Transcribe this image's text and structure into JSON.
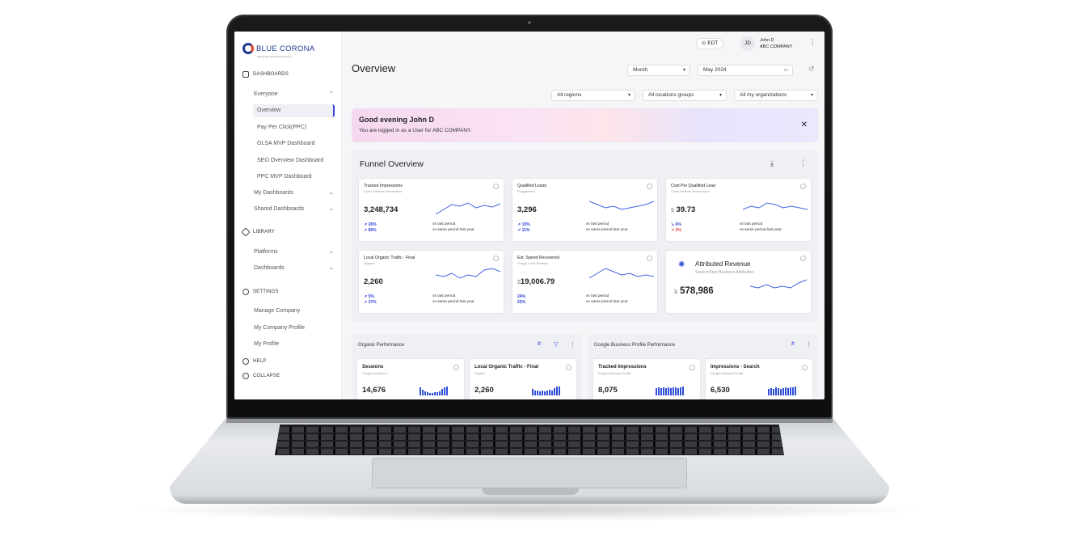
{
  "brand": {
    "name": "BLUE CORONA",
    "tagline": "Measurable Marketing Solutions"
  },
  "sidebar": {
    "dashboards_label": "DASHBOARDS",
    "everyone_label": "Everyone",
    "everyone_items": [
      "Overview",
      "Pay Per Click(PPC)",
      "OLSA MVP Dashboard",
      "SEO Overview Dashboard",
      "PPC MVP Dashboard"
    ],
    "my_dashboards": "My Dashboards",
    "shared_dashboards": "Shared Dashboards",
    "library_label": "LIBRARY",
    "platforms": "Platforms",
    "dashboards": "Dashboards",
    "settings_label": "SETTINGS",
    "settings_items": [
      "Manage Company",
      "My Company Profile",
      "My Profile"
    ],
    "help": "HELP",
    "collapse": "COLLAPSE"
  },
  "header": {
    "timezone": "⊙ EDT",
    "avatar": "JD",
    "user_name": "John D",
    "company": "ABC COMPANY"
  },
  "page": {
    "title": "Overview",
    "period": "Month",
    "date": "May 2024",
    "filters": [
      "All regions",
      "All locations groups",
      "All my organizations"
    ]
  },
  "banner": {
    "greeting": "Good evening John D",
    "message": "You are logged in as a User for ABC COMPANY."
  },
  "funnel": {
    "title": "Funnel Overview",
    "cards": [
      {
        "title": "Tracked Impressions",
        "subtitle": "Cross-Platform Performance",
        "value": "3,248,734",
        "d1": "↗ 26%",
        "d2": "↗ 86%",
        "l1": "vs last period",
        "l2": "vs same period last year"
      },
      {
        "title": "Qualified Leads",
        "subtitle": "Engagement",
        "value": "3,296",
        "d1": "↗ 15%",
        "d2": "↗ 11%",
        "l1": "vs last period",
        "l2": "vs same period last year"
      },
      {
        "title": "Cost Per Qualified Lead",
        "subtitle": "Cross-Platform Performance",
        "currency": "$",
        "value": "39.73",
        "d1": "↘ 6%",
        "d2": "↗ 3%",
        "l1": "vs last period",
        "l2": "vs same period last year"
      },
      {
        "title": "Local Organic Traffic - Final",
        "subtitle": "Organic",
        "value": "2,260",
        "d1": "↗ 5%",
        "d2": "↗ 37%",
        "l1": "vs last period",
        "l2": "vs same period last year"
      },
      {
        "title": "Est. Spend Recovered",
        "subtitle": "Google Local Reviews",
        "currency": "$",
        "value": "19,006.79",
        "d1": "24%",
        "d2": "22%",
        "l1": "vs last period",
        "l2": "vs same period last year"
      },
      {
        "title": "Attributed Revenue",
        "subtitle": "ServiceTitan Business Attribution",
        "currency": "$",
        "value": "578,986"
      }
    ]
  },
  "organic": {
    "title": "Organic Performance",
    "cards": [
      {
        "title": "Sessions",
        "subtitle": "Google Analytics 4",
        "value": "14,676"
      },
      {
        "title": "Local Organic Traffic - Final",
        "subtitle": "Organic",
        "value": "2,260"
      }
    ]
  },
  "gbp": {
    "title": "Google Business Profile Performance",
    "cards": [
      {
        "title": "Tracked Impressions",
        "subtitle": "Google Business Profile",
        "value": "8,075"
      },
      {
        "title": "Impressions - Search",
        "subtitle": "Google Business Profile",
        "value": "6,530"
      }
    ]
  },
  "colors": {
    "accent": "#2f3fd6",
    "down": "#e04040"
  }
}
